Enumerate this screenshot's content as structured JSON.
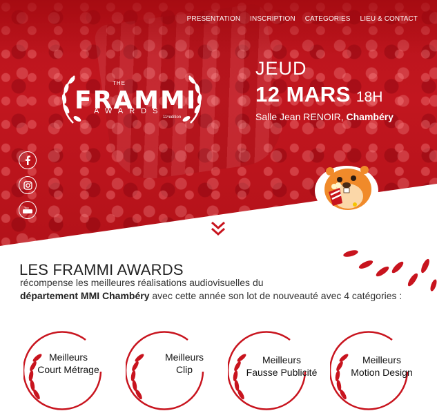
{
  "nav": {
    "items": [
      "PRESENTATION",
      "INSCRIPTION",
      "CATEGORIES",
      "LIEU & CONTACT"
    ]
  },
  "logo": {
    "the": "THE",
    "name": "FRAMMI",
    "sub": "AWARDS",
    "edition": "11ᵉedition"
  },
  "event": {
    "day": "JEUD",
    "date": "12 MARS",
    "hour": "18H",
    "venue_prefix": "Salle Jean RENOIR,",
    "venue_city": "Chambéry"
  },
  "social": {
    "icons": [
      "facebook-icon",
      "instagram-icon",
      "youtube-icon"
    ],
    "youtube_text": "You Tube"
  },
  "about": {
    "title": "LES FRAMMI AWARDS",
    "line1": "récompense les meilleures réalisations audiovisuelles du",
    "line2_bold": "département MMI Chambéry",
    "line2_rest": " avec cette année son lot de nouveauté avec 4 catégories :"
  },
  "categories": [
    {
      "line1": "Meilleurs",
      "line2": "Court Métrage"
    },
    {
      "line1": "Meilleurs",
      "line2": "Clip"
    },
    {
      "line1": "Meilleurs",
      "line2": "Fausse Publicité"
    },
    {
      "line1": "Meilleurs",
      "line2": "Motion Design"
    }
  ],
  "colors": {
    "accent": "#c8141e",
    "hero": "#b9141c",
    "text": "#222222"
  }
}
